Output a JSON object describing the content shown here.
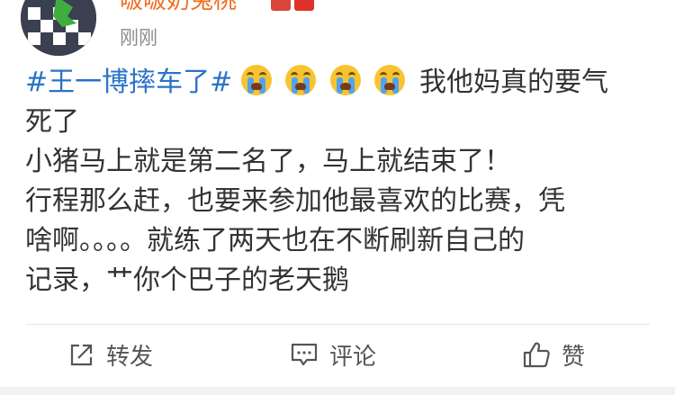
{
  "user": {
    "name": "啵啵奶兔桃",
    "timestamp": "刚刚"
  },
  "post": {
    "topic": "#王一博摔车了#",
    "emoji_icon": "crying-face-icon",
    "line1_text": "我他妈真的要气",
    "line2": "死了",
    "line3": "小猪马上就是第二名了，马上就结束了！",
    "line4": "行程那么赶，也要来参加他最喜欢的比赛，凭",
    "line5": "啥啊。。。。就练了两天也在不断刷新自己的",
    "line6": "记录，艹你个巴子的老天鹅"
  },
  "actions": {
    "repost_label": "转发",
    "comment_label": "评论",
    "like_label": "赞",
    "repost_icon": "repost-icon",
    "comment_icon": "comment-icon",
    "like_icon": "thumbs-up-icon"
  },
  "colors": {
    "username": "#f36d1f",
    "topic_link": "#2a72c8",
    "body_text": "#333333",
    "timestamp": "#8c8c8c"
  }
}
